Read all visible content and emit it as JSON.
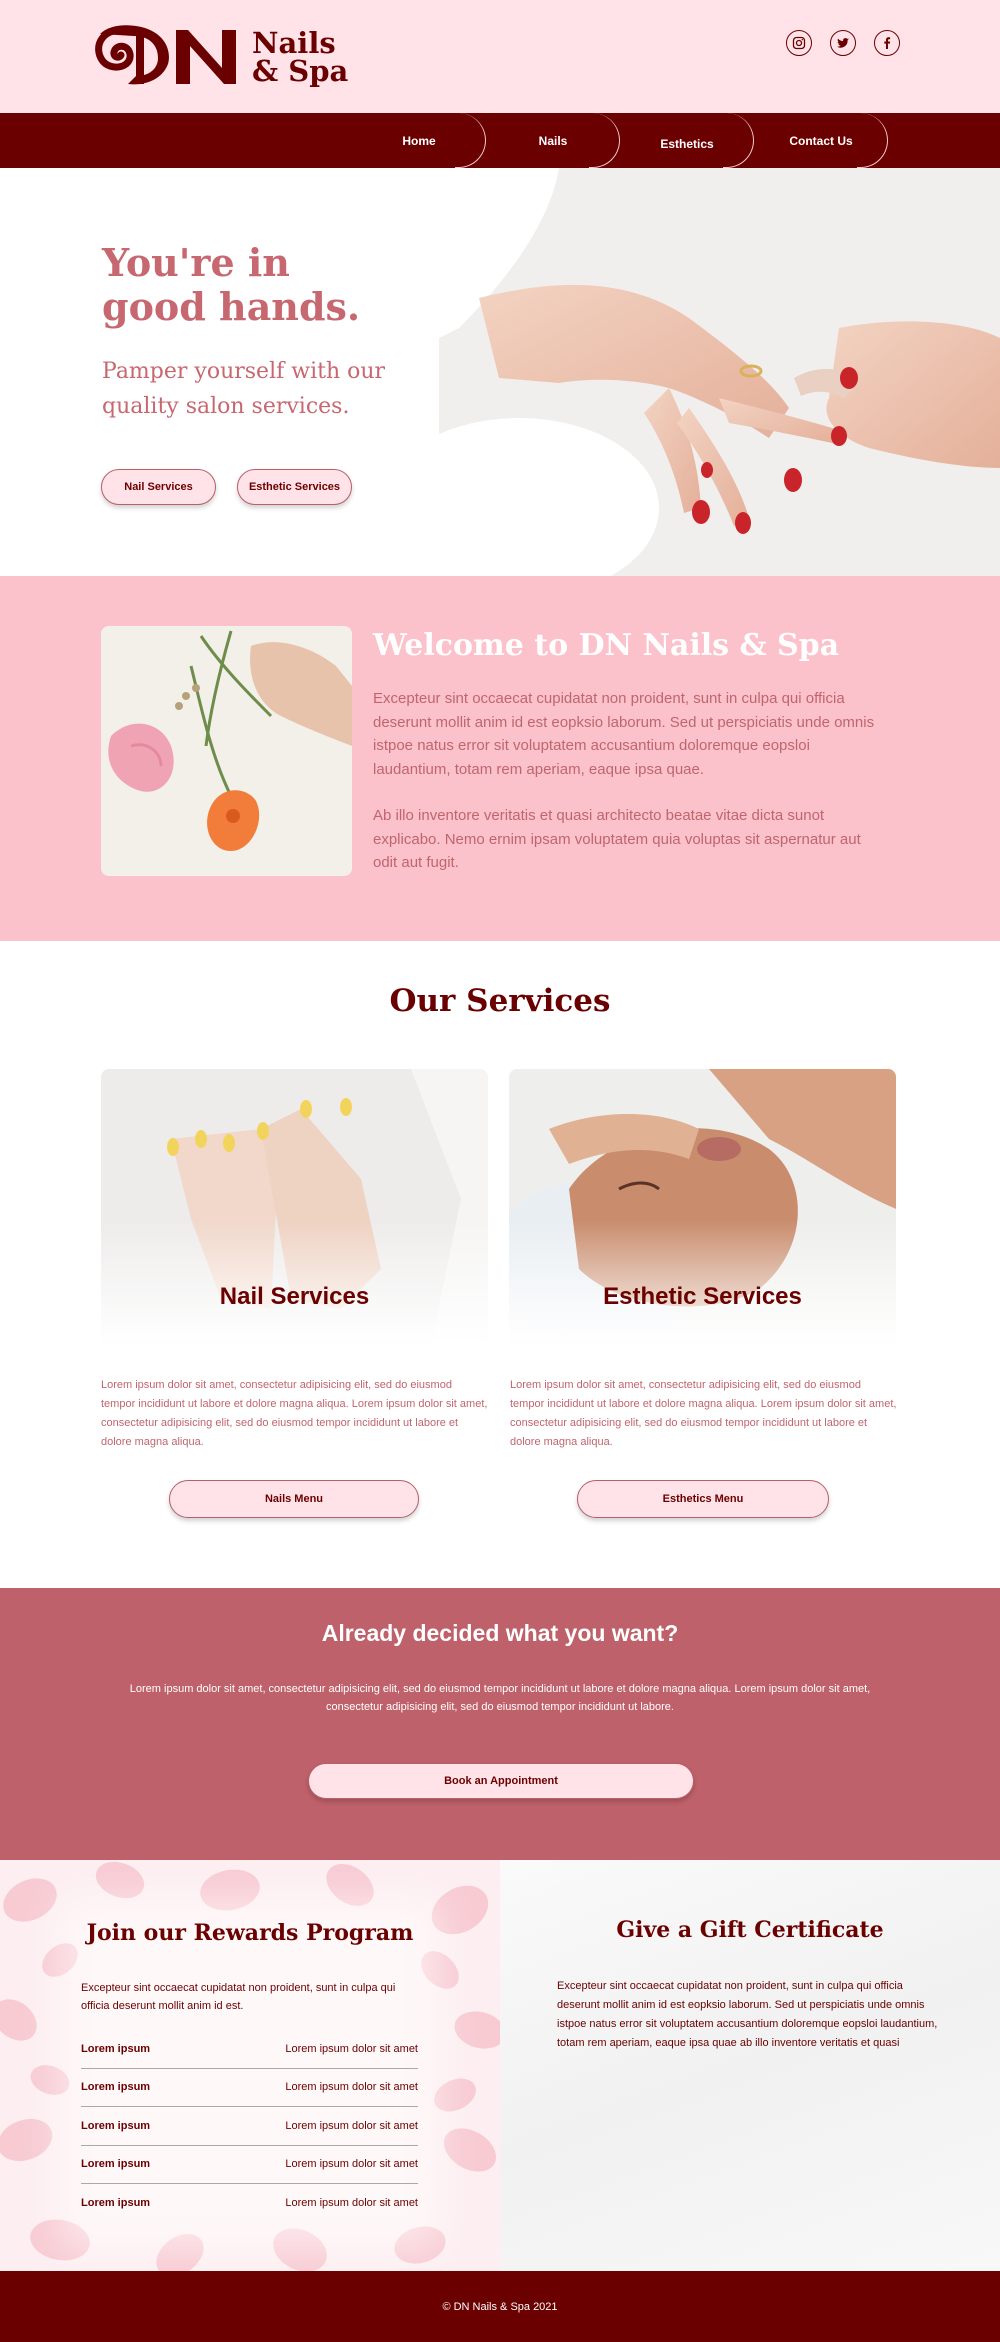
{
  "brand": {
    "name_line1": "Nails",
    "name_line2": "& Spa",
    "colors": {
      "maroon": "#6b0000",
      "rose": "#c7676f",
      "pink": "#fcc2cb",
      "blush": "#ffe3e8",
      "cta": "#bf616a"
    }
  },
  "socials": [
    {
      "icon": "instagram-icon"
    },
    {
      "icon": "twitter-icon"
    },
    {
      "icon": "facebook-icon"
    }
  ],
  "nav": {
    "items": [
      "Home",
      "Nails",
      "Esthetics",
      "Contact Us"
    ]
  },
  "hero": {
    "title": "You're in good hands.",
    "subtitle": "Pamper yourself with our quality salon services.",
    "buttons": [
      "Nail Services",
      "Esthetic Services"
    ]
  },
  "welcome": {
    "title": "Welcome to DN Nails & Spa",
    "paragraphs": [
      "Excepteur sint occaecat cupidatat non proident, sunt in culpa qui officia deserunt mollit anim id est eopksio laborum. Sed ut perspiciatis unde omnis istpoe natus error sit voluptatem accusantium doloremque eopsloi laudantium, totam rem aperiam, eaque ipsa quae.",
      "Ab illo inventore veritatis et quasi architecto beatae vitae dicta sunot explicabo. Nemo ernim ipsam voluptatem quia voluptas sit aspernatur aut odit aut fugit."
    ]
  },
  "services": {
    "title": "Our Services",
    "cards": [
      {
        "title": "Nail Services",
        "description": "Lorem ipsum dolor sit amet, consectetur adipisicing elit, sed do eiusmod tempor incididunt ut labore et dolore magna aliqua. Lorem ipsum dolor sit amet, consectetur adipisicing elit, sed do eiusmod tempor incididunt ut labore et dolore magna aliqua.",
        "button": "Nails Menu"
      },
      {
        "title": "Esthetic Services",
        "description": "Lorem ipsum dolor sit amet, consectetur adipisicing elit, sed do eiusmod tempor incididunt ut labore et dolore magna aliqua. Lorem ipsum dolor sit amet, consectetur adipisicing elit, sed do eiusmod tempor incididunt ut labore et dolore magna aliqua.",
        "button": "Esthetics Menu"
      }
    ]
  },
  "cta": {
    "title": "Already decided what you want?",
    "text": "Lorem ipsum dolor sit amet, consectetur adipisicing elit, sed do eiusmod tempor incididunt ut labore et dolore magna aliqua. Lorem ipsum dolor sit amet, consectetur adipisicing elit, sed do eiusmod tempor incididunt ut labore.",
    "button": "Book an Appointment"
  },
  "rewards": {
    "title": "Join our Rewards Program",
    "text": "Excepteur sint occaecat cupidatat non proident, sunt in culpa qui officia deserunt mollit anim id est.",
    "rows": [
      {
        "label": "Lorem ipsum",
        "value": "Lorem ipsum dolor sit amet"
      },
      {
        "label": "Lorem ipsum",
        "value": "Lorem ipsum dolor sit amet"
      },
      {
        "label": "Lorem ipsum",
        "value": "Lorem ipsum dolor sit amet"
      },
      {
        "label": "Lorem ipsum",
        "value": "Lorem ipsum dolor sit amet"
      },
      {
        "label": "Lorem ipsum",
        "value": "Lorem ipsum dolor sit amet"
      }
    ]
  },
  "gift": {
    "title": "Give a Gift Certificate",
    "text": "Excepteur sint occaecat cupidatat non proident, sunt in culpa qui officia deserunt mollit anim id est eopksio laborum. Sed ut perspiciatis unde omnis istpoe natus error sit voluptatem accusantium doloremque eopsloi laudantium, totam rem aperiam, eaque ipsa quae ab illo inventore veritatis et quasi"
  },
  "footer": {
    "text": "© DN Nails & Spa 2021"
  }
}
